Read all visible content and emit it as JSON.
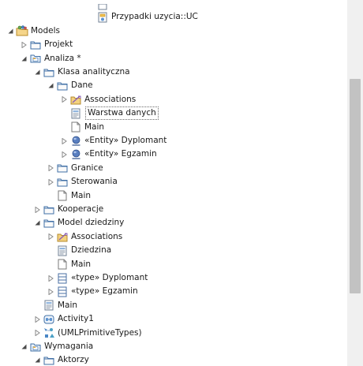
{
  "tree": [
    {
      "label": "",
      "depth": 6,
      "toggle": "none",
      "icon": "stereotype-icon",
      "partial": true
    },
    {
      "label": "Przypadki uzycia::UC",
      "depth": 6,
      "toggle": "none",
      "icon": "diagram-icon"
    },
    {
      "label": "Models",
      "depth": 0,
      "toggle": "expanded",
      "icon": "model-icon"
    },
    {
      "label": "Projekt",
      "depth": 1,
      "toggle": "collapsed",
      "icon": "folder-icon"
    },
    {
      "label": "Analiza *",
      "depth": 1,
      "toggle": "expanded",
      "icon": "package-icon"
    },
    {
      "label": "Klasa analityczna",
      "depth": 2,
      "toggle": "expanded",
      "icon": "folder-icon"
    },
    {
      "label": "Dane",
      "depth": 3,
      "toggle": "expanded",
      "icon": "folder-icon"
    },
    {
      "label": "Associations",
      "depth": 4,
      "toggle": "collapsed",
      "icon": "associations-folder-icon"
    },
    {
      "label": "Warstwa danych",
      "depth": 4,
      "toggle": "none",
      "icon": "class-diagram-icon",
      "selected": true
    },
    {
      "label": "Main",
      "depth": 4,
      "toggle": "none",
      "icon": "document-icon"
    },
    {
      "label": "«Entity» Dyplomant",
      "depth": 4,
      "toggle": "collapsed",
      "icon": "entity-icon"
    },
    {
      "label": "«Entity» Egzamin",
      "depth": 4,
      "toggle": "collapsed",
      "icon": "entity-icon"
    },
    {
      "label": "Granice",
      "depth": 3,
      "toggle": "collapsed",
      "icon": "folder-icon"
    },
    {
      "label": "Sterowania",
      "depth": 3,
      "toggle": "collapsed",
      "icon": "folder-icon"
    },
    {
      "label": "Main",
      "depth": 3,
      "toggle": "none",
      "icon": "document-icon"
    },
    {
      "label": "Kooperacje",
      "depth": 2,
      "toggle": "collapsed",
      "icon": "folder-icon"
    },
    {
      "label": "Model dziedziny",
      "depth": 2,
      "toggle": "expanded",
      "icon": "folder-icon"
    },
    {
      "label": "Associations",
      "depth": 3,
      "toggle": "collapsed",
      "icon": "associations-folder-icon"
    },
    {
      "label": "Dziedzina",
      "depth": 3,
      "toggle": "none",
      "icon": "class-diagram-icon"
    },
    {
      "label": "Main",
      "depth": 3,
      "toggle": "none",
      "icon": "document-icon"
    },
    {
      "label": "«type» Dyplomant",
      "depth": 3,
      "toggle": "collapsed",
      "icon": "type-class-icon"
    },
    {
      "label": "«type» Egzamin",
      "depth": 3,
      "toggle": "collapsed",
      "icon": "type-class-icon"
    },
    {
      "label": "Main",
      "depth": 2,
      "toggle": "none",
      "icon": "class-diagram-icon"
    },
    {
      "label": "Activity1",
      "depth": 2,
      "toggle": "collapsed",
      "icon": "activity-icon"
    },
    {
      "label": "(UMLPrimitiveTypes)",
      "depth": 2,
      "toggle": "collapsed",
      "icon": "primitive-types-icon"
    },
    {
      "label": "Wymagania",
      "depth": 1,
      "toggle": "expanded",
      "icon": "package-icon"
    },
    {
      "label": "Aktorzy",
      "depth": 2,
      "toggle": "expanded",
      "icon": "folder-icon"
    }
  ]
}
